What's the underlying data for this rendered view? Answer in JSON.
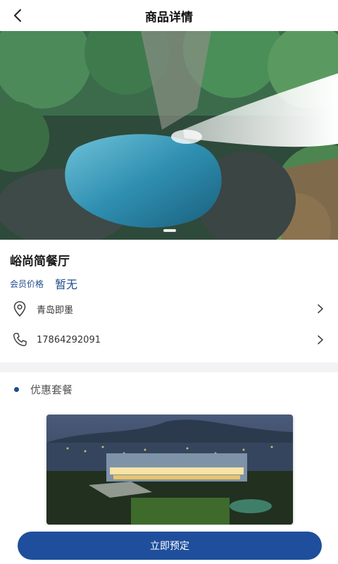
{
  "header": {
    "title": "商品详情",
    "back_icon": "chevron-left-icon"
  },
  "hero": {
    "slide_count": 1,
    "active_slide": 1
  },
  "shop": {
    "name": "峪尚简餐厅",
    "price_label": "会员价格",
    "price_value": "暂无"
  },
  "info": {
    "address": "青岛即墨",
    "address_icon": "location-pin-icon",
    "phone": "17864292091",
    "phone_icon": "phone-icon"
  },
  "section": {
    "title": "优惠套餐"
  },
  "footer": {
    "book_label": "立即预定"
  },
  "colors": {
    "accent": "#1f4c8c",
    "button": "#1f4f9c",
    "band": "#f3f3f5"
  }
}
